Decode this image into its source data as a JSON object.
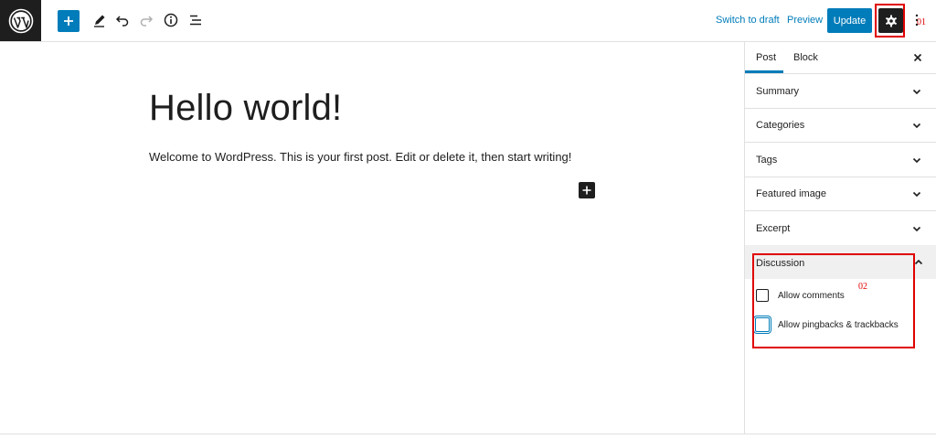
{
  "toolbar": {
    "switch_to_draft": "Switch to draft",
    "preview": "Preview",
    "update": "Update"
  },
  "icons": {
    "logo": "wordpress-logo-icon",
    "add": "plus-icon",
    "tools": "pencil-icon",
    "undo": "undo-icon",
    "redo": "redo-icon",
    "details": "info-icon",
    "outline": "list-view-icon",
    "settings": "gear-icon",
    "more": "more-vertical-icon"
  },
  "annotations": {
    "one": "01",
    "two": "02"
  },
  "editor": {
    "title": "Hello world!",
    "paragraph": "Welcome to WordPress. This is your first post. Edit or delete it, then start writing!"
  },
  "sidebar": {
    "tabs": [
      {
        "label": "Post",
        "active": true
      },
      {
        "label": "Block",
        "active": false
      }
    ],
    "panels": [
      {
        "label": "Summary"
      },
      {
        "label": "Categories"
      },
      {
        "label": "Tags"
      },
      {
        "label": "Featured image"
      },
      {
        "label": "Excerpt"
      }
    ],
    "discussion": {
      "label": "Discussion",
      "options": [
        {
          "label": "Allow comments",
          "checked": false
        },
        {
          "label": "Allow pingbacks & trackbacks",
          "checked": false
        }
      ]
    }
  },
  "colors": {
    "accent": "#007cba",
    "dark": "#1e1e1e",
    "annotation": "#e00000"
  }
}
